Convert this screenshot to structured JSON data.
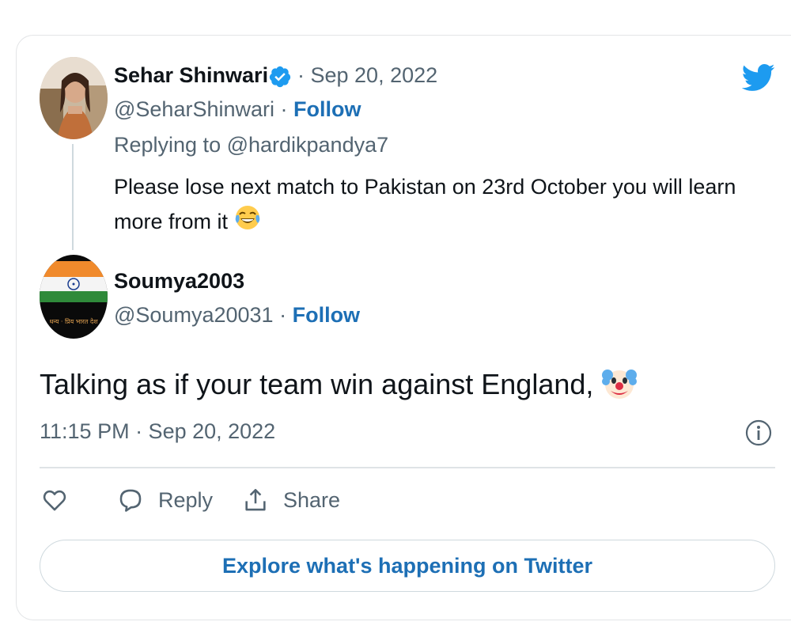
{
  "original_tweet": {
    "display_name": "Sehar Shinwari",
    "date": "· Sep 20, 2022",
    "handle": "@SeharShinwari",
    "separator": "·",
    "follow_label": "Follow",
    "replying_to": "Replying to @hardikpandya7",
    "text": "Please lose next match to Pakistan on 23rd October you will learn more from it",
    "emoji": "face-with-tears-of-joy-emoji"
  },
  "reply_tweet": {
    "display_name": "Soumya2003",
    "handle": "@Soumya20031",
    "separator": "·",
    "follow_label": "Follow",
    "text": "Talking as if your team win against England,",
    "emoji": "clown-face-emoji",
    "avatar_caption": "धन्य · प्रिय भारत देश",
    "timestamp": "11:15 PM · Sep 20, 2022"
  },
  "actions": {
    "like_icon": "heart-icon",
    "reply_label": "Reply",
    "share_label": "Share"
  },
  "explore_label": "Explore what's happening on Twitter",
  "colors": {
    "twitter_blue": "#1d9bf0",
    "link_blue": "#1d6fb5",
    "text": "#0f1419",
    "muted": "#536471",
    "border": "#cfd9de"
  }
}
